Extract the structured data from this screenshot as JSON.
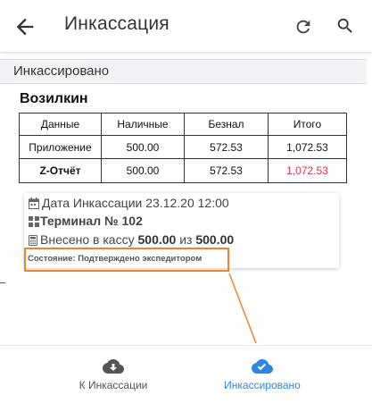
{
  "appbar": {
    "title": "Инкассация",
    "icons": [
      "arrow-back-icon",
      "refresh-icon",
      "search-icon"
    ]
  },
  "section": {
    "header": "Инкассировано"
  },
  "person": {
    "name": "Возилкин"
  },
  "table": {
    "headers": [
      "Данные",
      "Наличные",
      "Безнал",
      "Итого"
    ],
    "rows": [
      [
        "Приложение",
        "500.00",
        "572.53",
        "1,072.53"
      ],
      [
        "Z-Отчёт",
        "500.00",
        "572.53",
        "1,072.53"
      ]
    ],
    "highlight_color": "#e0344c"
  },
  "card": {
    "date_label": "Дата Инкассации",
    "date_value": "23.12.20 12:00",
    "terminal": "Терминал № 102",
    "deposited_prefix": "Внесено в кассу",
    "deposited_amount": "500.00",
    "deposited_of": "из",
    "deposited_total": "500.00",
    "status": "Состояние: Подтверждено экспедитором"
  },
  "annotation": {
    "color": "#f0822d"
  },
  "bottom_nav": {
    "items": [
      {
        "label": "К Инкассации",
        "icon": "cloud-download-icon",
        "active": false
      },
      {
        "label": "Инкассировано",
        "icon": "cloud-done-icon",
        "active": true
      }
    ],
    "active_color": "#2d86e0"
  }
}
